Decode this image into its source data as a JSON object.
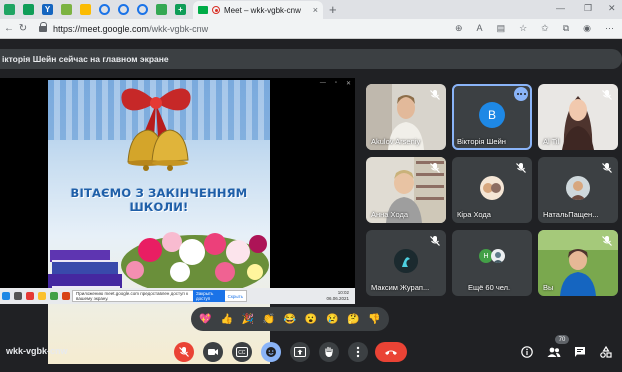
{
  "browser": {
    "active_tab_title": "Meet – wkk-vgbk-cnw",
    "url_host": "https://meet.google.com",
    "url_path": "/wkk-vgbk-cnw",
    "new_tab_label": "+",
    "close_tab_label": "×"
  },
  "banner": {
    "text": "ікторія Шейн сейчас на главном экране"
  },
  "slide": {
    "headline": "ВІТАЄМО З ЗАКІНЧЕННЯМ ШКОЛИ!",
    "notification_text": "Приложению meet.google.com предоставлен доступ к вашему экрану.",
    "notification_stop": "Закрыть доступ",
    "notification_hide": "Скрыть",
    "clock_time": "10:02",
    "clock_date": "06.06.2021",
    "lang": "УКР"
  },
  "participants": [
    {
      "name": "Akulov Arseniy"
    },
    {
      "name": "Вікторія Шейн",
      "initial": "B",
      "color": "#1e88e5"
    },
    {
      "name": "Al Til"
    },
    {
      "name": "Анна Хода"
    },
    {
      "name": "Кіра Хода"
    },
    {
      "name": "НатальПащен..."
    },
    {
      "name": "Максим Журап..."
    },
    {
      "name": "Ещё 60 чел.",
      "chip": "H"
    },
    {
      "name": "Вы"
    }
  ],
  "reactions": [
    "💖",
    "👍",
    "🎉",
    "👏",
    "😂",
    "😮",
    "😢",
    "🤔",
    "👎"
  ],
  "bottom": {
    "meeting_code": "wkk-vgbk-cnw",
    "people_count": "70"
  },
  "colors": {
    "accent": "#8ab4f8",
    "hangup": "#ea4335",
    "bg": "#202124",
    "tile": "#3c4043"
  }
}
